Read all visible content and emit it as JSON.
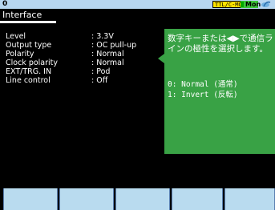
{
  "status": {
    "slot": "0",
    "logic_level": "TTL/C-MOS",
    "monitor": "Mon",
    "network_icon": "network-icon"
  },
  "page": {
    "title": "Interface"
  },
  "settings": [
    {
      "label": "Level",
      "value": ": 3.3V"
    },
    {
      "label": "Output type",
      "value": ": OC pull-up"
    },
    {
      "label": "Polarity",
      "value": ": Normal"
    },
    {
      "label": "Clock polarity",
      "value": ": Normal"
    },
    {
      "label": "EXT/TRG. IN",
      "value": ": Pod"
    },
    {
      "label": "Line control",
      "value": ": Off"
    }
  ],
  "help": {
    "text": "数字キーまたは◀▶で通信ラインの極性を選択します。",
    "option_1": "0: Normal (通常)",
    "option_2": "1: Invert (反転)"
  },
  "softkeys": [
    "",
    "",
    "",
    "",
    ""
  ],
  "colors": {
    "status_bar": "#b7d6f0",
    "logic_badge": "#ffe400",
    "mon_badge": "#3cc83c",
    "help_panel": "#39a245",
    "softkey": "#b9dbef"
  }
}
